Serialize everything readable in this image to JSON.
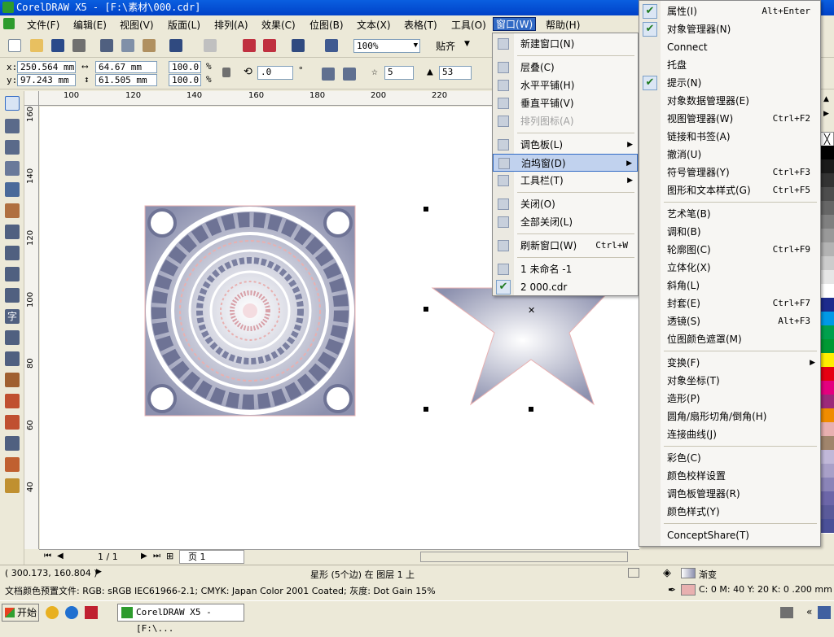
{
  "window": {
    "title": "CorelDRAW X5 - [F:\\素材\\000.cdr]"
  },
  "menubar": [
    "文件(F)",
    "编辑(E)",
    "视图(V)",
    "版面(L)",
    "排列(A)",
    "效果(C)",
    "位图(B)",
    "文本(X)",
    "表格(T)",
    "工具(O)",
    "窗口(W)",
    "帮助(H)"
  ],
  "toolbar": {
    "zoom": "100%",
    "snap_label": "贴齐"
  },
  "propbar": {
    "x": "250.564 mm",
    "y": "97.243 mm",
    "w": "64.67 mm",
    "h": "61.505 mm",
    "sx": "100.0",
    "sy": "100.0",
    "pct": "%",
    "angle": ".0",
    "deg": "°",
    "points": "5",
    "sharpness": "53"
  },
  "ruler_h": [
    "100",
    "120",
    "140",
    "160",
    "180",
    "200",
    "220"
  ],
  "ruler_v": [
    "160",
    "140",
    "120",
    "100",
    "80",
    "60",
    "40"
  ],
  "window_menu": [
    {
      "label": "新建窗口(N)",
      "type": "item"
    },
    {
      "type": "sep"
    },
    {
      "label": "层叠(C)",
      "type": "item"
    },
    {
      "label": "水平平铺(H)",
      "type": "item"
    },
    {
      "label": "垂直平铺(V)",
      "type": "item"
    },
    {
      "label": "排列图标(A)",
      "type": "item",
      "disabled": true
    },
    {
      "type": "sep"
    },
    {
      "label": "调色板(L)",
      "type": "sub"
    },
    {
      "label": "泊坞窗(D)",
      "type": "sub",
      "highlight": true
    },
    {
      "label": "工具栏(T)",
      "type": "sub"
    },
    {
      "type": "sep"
    },
    {
      "label": "关闭(O)",
      "type": "item"
    },
    {
      "label": "全部关闭(L)",
      "type": "item"
    },
    {
      "type": "sep"
    },
    {
      "label": "刷新窗口(W)",
      "type": "item",
      "shortcut": "Ctrl+W"
    },
    {
      "type": "sep"
    },
    {
      "label": "1 未命名 -1",
      "type": "item"
    },
    {
      "label": "2 000.cdr",
      "type": "item",
      "checked": true
    }
  ],
  "docker_menu": [
    {
      "label": "属性(I)",
      "shortcut": "Alt+Enter",
      "checked": true
    },
    {
      "label": "对象管理器(N)",
      "checked": true
    },
    {
      "label": "Connect"
    },
    {
      "label": "托盘"
    },
    {
      "label": "提示(N)",
      "checked": true
    },
    {
      "label": "对象数据管理器(E)"
    },
    {
      "label": "视图管理器(W)",
      "shortcut": "Ctrl+F2"
    },
    {
      "label": "链接和书签(A)"
    },
    {
      "label": "撤消(U)"
    },
    {
      "label": "符号管理器(Y)",
      "shortcut": "Ctrl+F3"
    },
    {
      "label": "图形和文本样式(G)",
      "shortcut": "Ctrl+F5"
    },
    {
      "sep": true
    },
    {
      "label": "艺术笔(B)"
    },
    {
      "label": "调和(B)"
    },
    {
      "label": "轮廓图(C)",
      "shortcut": "Ctrl+F9"
    },
    {
      "label": "立体化(X)"
    },
    {
      "label": "斜角(L)"
    },
    {
      "label": "封套(E)",
      "shortcut": "Ctrl+F7"
    },
    {
      "label": "透镜(S)",
      "shortcut": "Alt+F3"
    },
    {
      "label": "位图颜色遮罩(M)"
    },
    {
      "sep": true
    },
    {
      "label": "变换(F)",
      "sub": true
    },
    {
      "label": "对象坐标(T)"
    },
    {
      "label": "造形(P)"
    },
    {
      "label": "圆角/扇形切角/倒角(H)"
    },
    {
      "label": "连接曲线(J)"
    },
    {
      "sep": true
    },
    {
      "label": "彩色(C)"
    },
    {
      "label": "颜色校样设置"
    },
    {
      "label": "调色板管理器(R)"
    },
    {
      "label": "颜色样式(Y)"
    },
    {
      "sep": true
    },
    {
      "label": "ConceptShare(T)"
    }
  ],
  "pagebar": {
    "counter": "1 / 1",
    "tab": "页 1"
  },
  "status": {
    "coords": "( 300.173, 160.804 )",
    "selection": "星形 (5个边) 在 图层 1 上",
    "fill_label": "渐变",
    "color_profile": "文档颜色预置文件: RGB: sRGB IEC61966-2.1; CMYK: Japan Color 2001 Coated; 灰度: Dot Gain 15%",
    "outline": "C: 0 M: 40 Y: 20 K: 0  .200 mm"
  },
  "taskbar": {
    "start": "开始",
    "task": "CorelDRAW X5 - [F:\\..."
  },
  "colors": {
    "palette": [
      "#ffffff",
      "#000000",
      "#1a1a1a",
      "#333333",
      "#4d4d4d",
      "#666666",
      "#808080",
      "#999999",
      "#b3b3b3",
      "#cccccc",
      "#e6e6e6",
      "#ffffff",
      "#1c2b8c",
      "#0099e6",
      "#00a04d",
      "#009933",
      "#ffee00",
      "#e60012",
      "#e4007f",
      "#9c2a7a",
      "#f08c00",
      "#e8b0b0",
      "#a0856c",
      "#c0b8d8",
      "#a8a0c8",
      "#8a84b8",
      "#6c66a8",
      "#5a5a9a",
      "#4a5098"
    ],
    "accent": "#316ac5",
    "pattern_bg": "#8c90ae",
    "outline": "#e8b0b0"
  }
}
